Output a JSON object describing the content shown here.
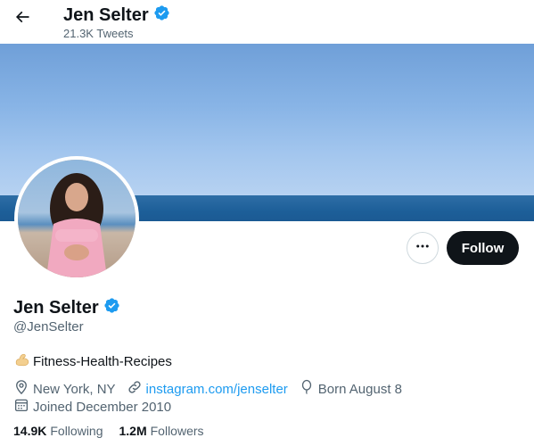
{
  "header": {
    "name": "Jen Selter",
    "tweet_count": "21.3K Tweets"
  },
  "actions": {
    "follow_label": "Follow"
  },
  "profile": {
    "name": "Jen Selter",
    "handle": "@JenSelter",
    "bio_text": "Fitness-Health-Recipes",
    "location": "New York, NY",
    "website": "instagram.com/jenselter",
    "birthday": "Born August 8",
    "joined": "Joined December 2010"
  },
  "stats": {
    "following_count": "14.9K",
    "following_label": "Following",
    "followers_count": "1.2M",
    "followers_label": "Followers"
  },
  "colors": {
    "accent": "#1d9bf0",
    "text": "#0f1419",
    "secondary": "#536471",
    "follow_bg": "#0f1419"
  },
  "icons": [
    "back-arrow-icon",
    "verified-badge-icon",
    "more-icon",
    "flexed-biceps-emoji",
    "location-pin-icon",
    "link-icon",
    "balloon-icon",
    "calendar-icon"
  ]
}
